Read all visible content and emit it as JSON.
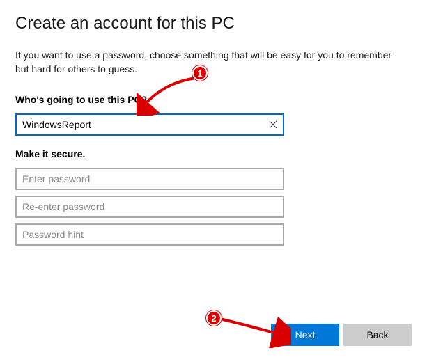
{
  "title": "Create an account for this PC",
  "description": "If you want to use a password, choose something that will be easy for you to remember but hard for others to guess.",
  "section_user": {
    "label": "Who's going to use this PC?",
    "username_value": "WindowsReport"
  },
  "section_secure": {
    "label": "Make it secure.",
    "password_placeholder": "Enter password",
    "confirm_placeholder": "Re-enter password",
    "hint_placeholder": "Password hint"
  },
  "buttons": {
    "next": "Next",
    "back": "Back"
  },
  "annotations": {
    "badge1": "1",
    "badge2": "2"
  }
}
